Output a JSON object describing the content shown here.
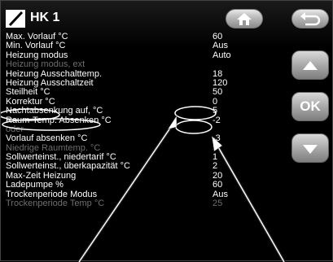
{
  "header": {
    "title": "HK 1",
    "home_icon": "home-icon",
    "back_icon": "back-arrow-icon",
    "logo_icon": "diagonal-slash-icon"
  },
  "side_buttons": {
    "up_icon": "triangle-up-icon",
    "ok_label": "OK",
    "down_icon": "triangle-down-icon"
  },
  "rows": [
    {
      "label": "Max. Vorlauf °C",
      "value": "60",
      "dim": false
    },
    {
      "label": "Min. Vorlauf °C",
      "value": "Aus",
      "dim": false
    },
    {
      "label": "Heizung modus",
      "value": "Auto",
      "dim": false
    },
    {
      "label": "Heizung modus, ext",
      "value": "",
      "dim": true
    },
    {
      "label": "Heizung Ausschalttemp.",
      "value": "18",
      "dim": false
    },
    {
      "label": "Heizung Ausschaltzeit",
      "value": "120",
      "dim": false
    },
    {
      "label": "Steilheit °C",
      "value": "50",
      "dim": false
    },
    {
      "label": "Korrektur °C",
      "value": "0",
      "dim": false
    },
    {
      "label": "Nachtabsenkung auf, °C",
      "value": "5",
      "dim": false
    },
    {
      "label": "Raum-Temp. Absenken °C",
      "value": "-2",
      "dim": false
    },
    {
      "label": "oder",
      "value": "",
      "dim": true
    },
    {
      "label": "Vorlauf absenken °C",
      "value": "-3",
      "dim": false
    },
    {
      "label": "Niedrige Raumtemp. °C",
      "value": "5",
      "dim": true
    },
    {
      "label": "Sollwerteinst., niedertarif °C",
      "value": "1",
      "dim": false
    },
    {
      "label": "Sollwerteinst., überkapazität °C",
      "value": "2",
      "dim": false
    },
    {
      "label": "Max-Zeit Heizung",
      "value": "20",
      "dim": false
    },
    {
      "label": "Ladepumpe %",
      "value": "60",
      "dim": false
    },
    {
      "label": "Trockenperiode Modus",
      "value": "Aus",
      "dim": false
    },
    {
      "label": "Trockenperiode Temp °C",
      "value": "25",
      "dim": true
    }
  ],
  "colors": {
    "text": "#ffffff",
    "dim_text": "#6e6e6e",
    "annotation": "#ffffff"
  }
}
